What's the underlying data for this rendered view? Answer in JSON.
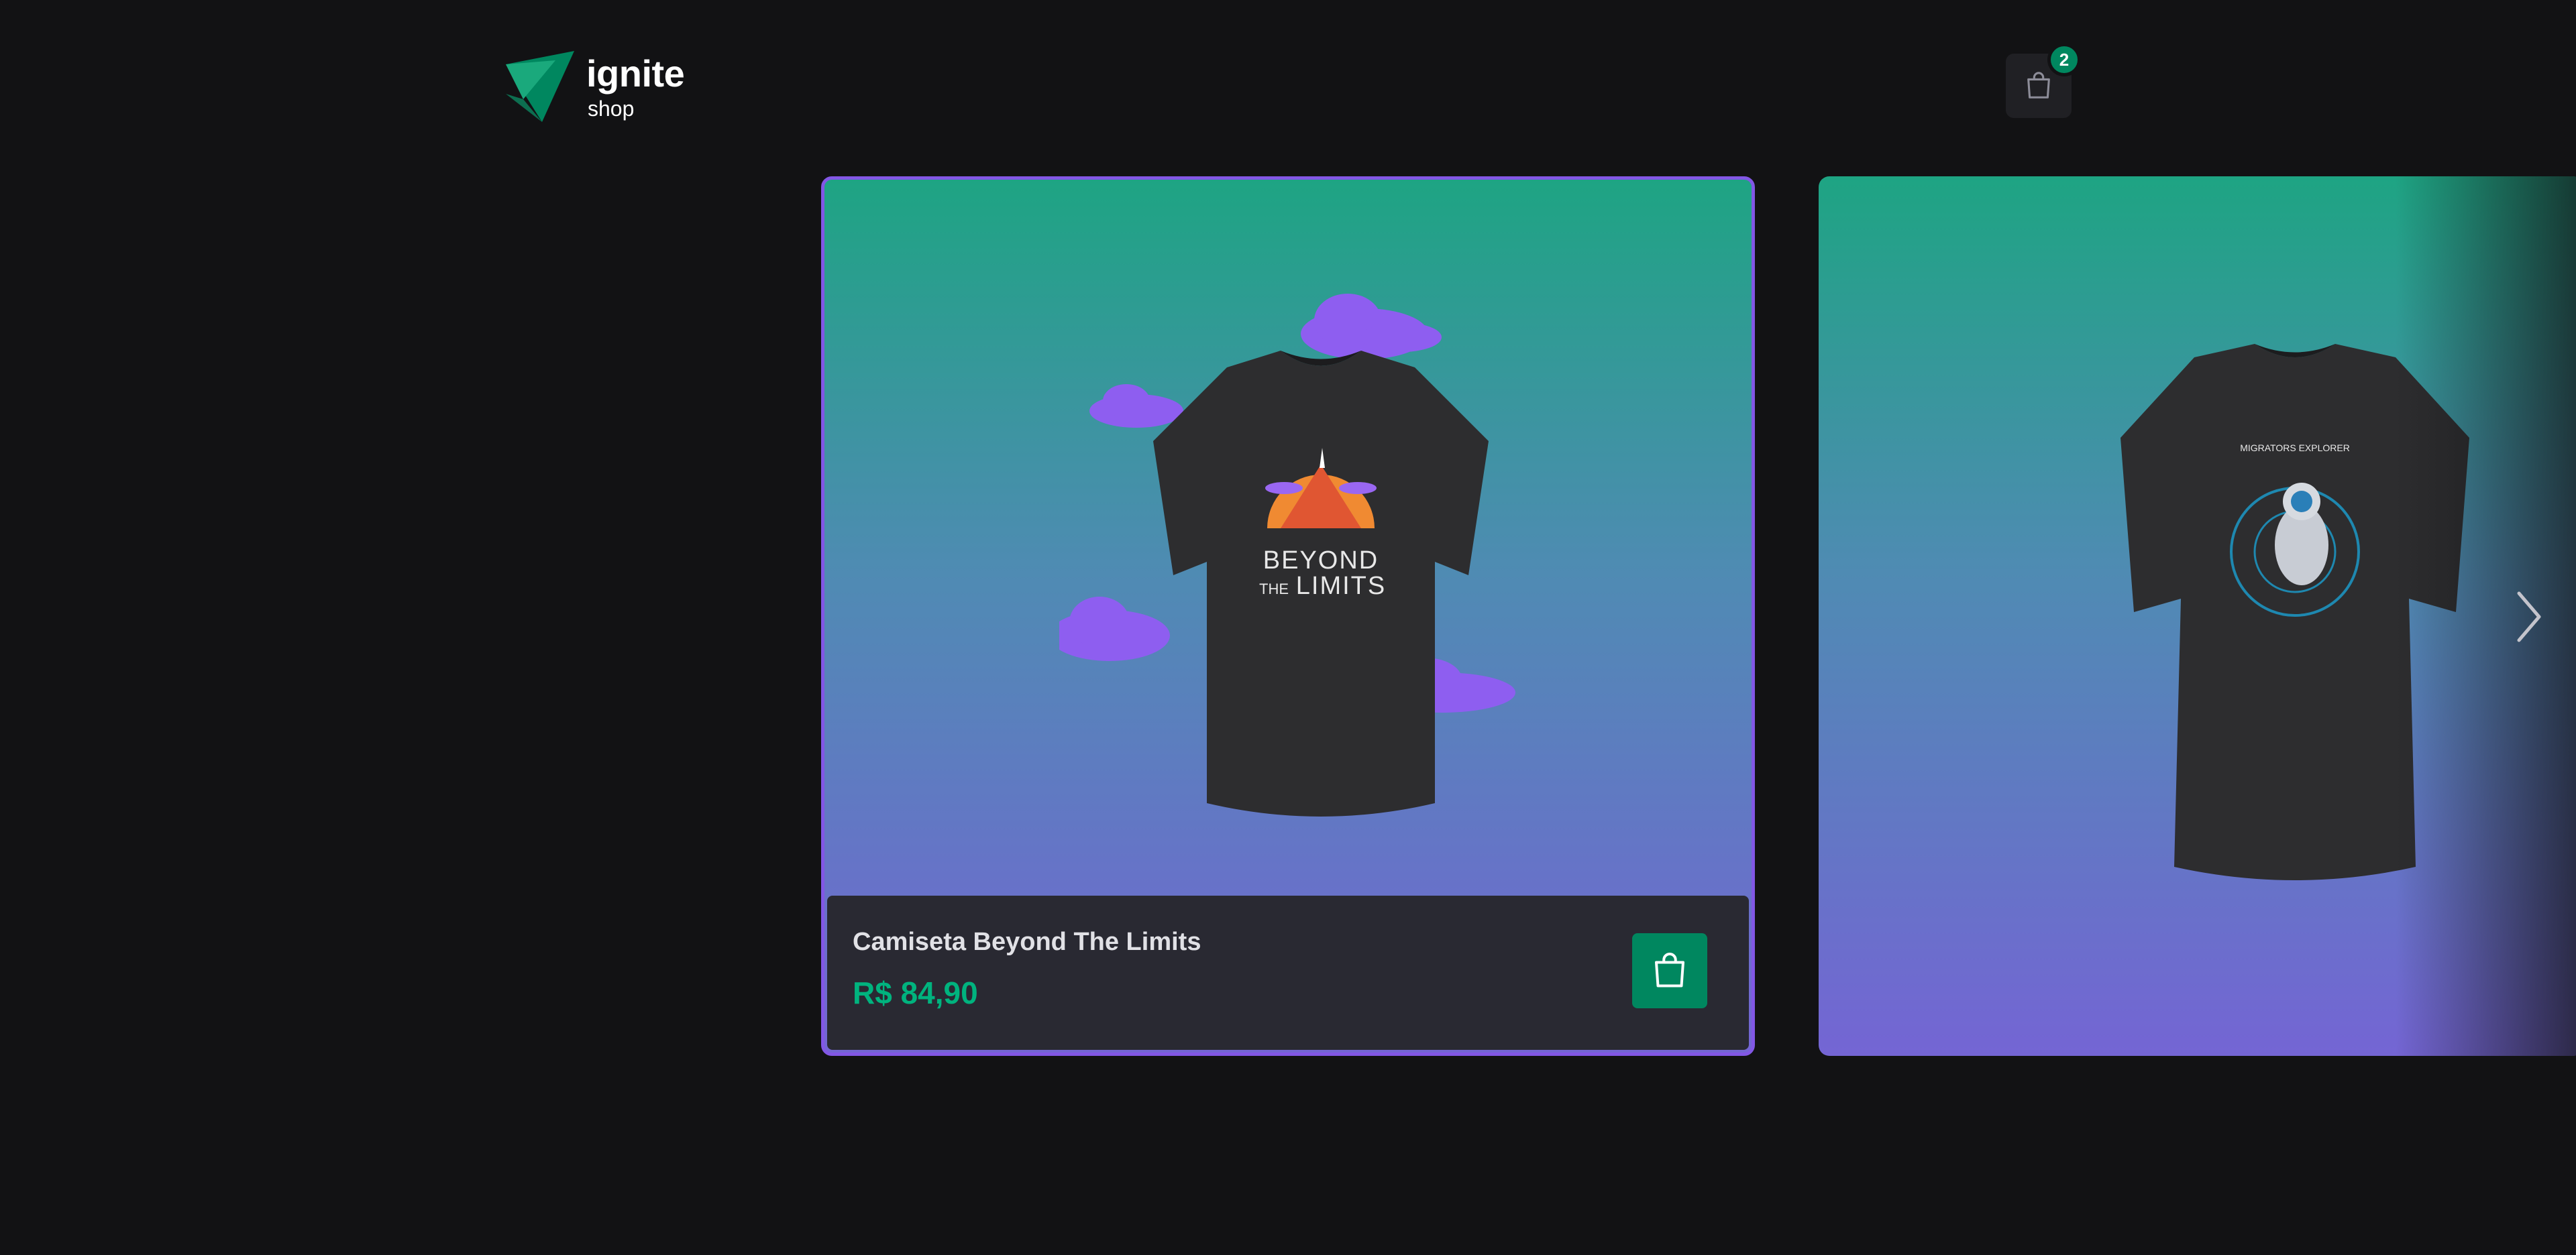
{
  "header": {
    "logo_main": "ignite",
    "logo_sub": "shop",
    "cart_icon": "shopping-bag-icon",
    "cart_count": "2"
  },
  "products": [
    {
      "name": "Camiseta Beyond The Limits",
      "price": "R$ 84,90",
      "print_line1": "BEYOND",
      "print_line2": "THE",
      "print_line3": "LIMITS",
      "cart_icon": "shopping-bag-icon"
    },
    {
      "print_text": "MIGRATORS EXPLORER"
    }
  ],
  "navigation": {
    "next_icon": "chevron-right-icon"
  },
  "colors": {
    "background": "#121214",
    "accent": "#00875f",
    "price": "#00b37e",
    "card_border": "#8257e5",
    "footer": "#292932"
  }
}
